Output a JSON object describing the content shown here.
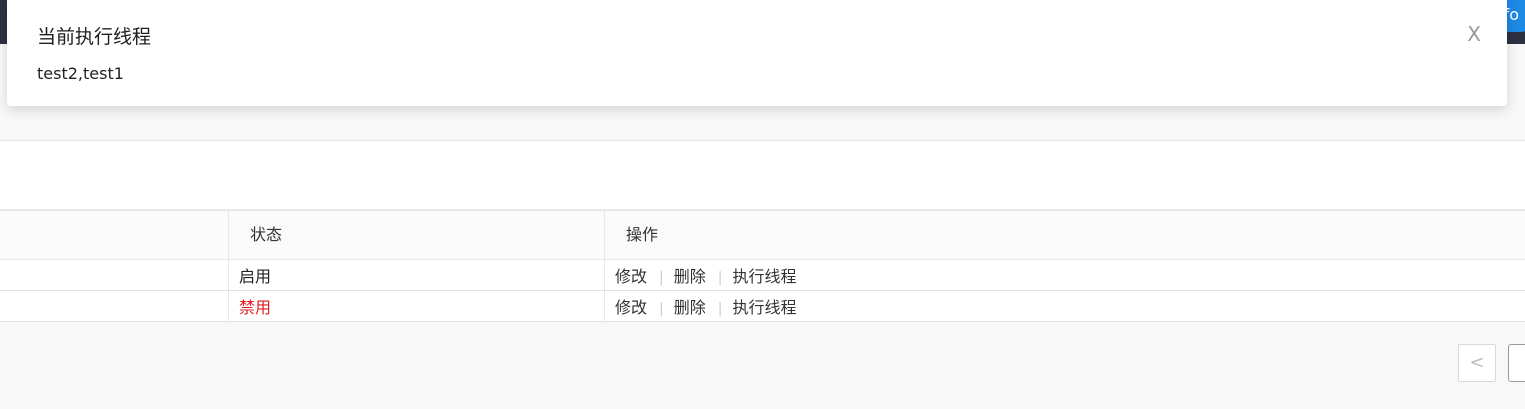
{
  "header": {
    "user_badge": "nfo"
  },
  "notification": {
    "title": "当前执行线程",
    "body": "test2,test1",
    "close_label": "X"
  },
  "table": {
    "columns": [
      "",
      "状态",
      "操作"
    ],
    "rows": [
      {
        "status": "启用",
        "status_color": "#222222",
        "actions": [
          "修改",
          "删除",
          "执行线程"
        ]
      },
      {
        "status": "禁用",
        "status_color": "#e02020",
        "actions": [
          "修改",
          "删除",
          "执行线程"
        ]
      }
    ]
  },
  "pagination": {
    "prev_label": "<"
  }
}
